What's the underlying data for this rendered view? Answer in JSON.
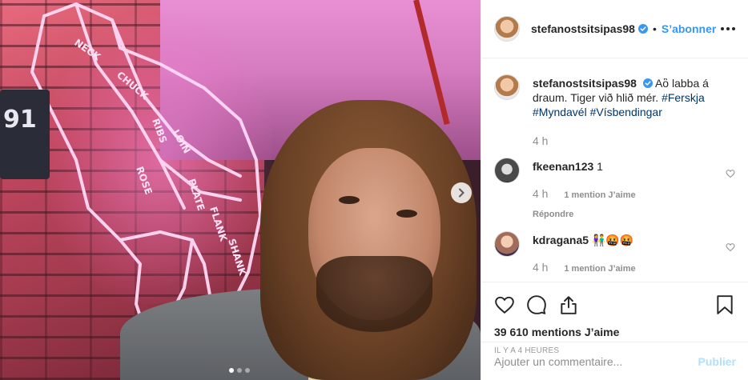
{
  "post": {
    "photo_alt": "selfie photo with pink neon beef cut sign",
    "neon_words": [
      "NECK",
      "CHUCK",
      "RIBS",
      "LOIN",
      "ROSE",
      "PLATE",
      "FLANK",
      "SHANK"
    ],
    "sign_text": "91",
    "carousel": {
      "dots": 3,
      "active": 0
    }
  },
  "header": {
    "username": "stefanostsitsipas98",
    "separator": "•",
    "follow_label": "S’abonner"
  },
  "caption": {
    "username": "stefanostsitsipas98",
    "text": "Aὃ labba á draum. Tiger við hlið mér.",
    "hashtags": [
      "#Ferskja",
      "#Myndavél",
      "#Vísbendingar"
    ],
    "time": "4 h"
  },
  "comments": [
    {
      "username": "fkeenan123",
      "text": "1",
      "time": "4 h",
      "likes": "1 mention J’aime",
      "reply": "Répondre"
    },
    {
      "username": "kdragana5",
      "text": "👫🤬🤬",
      "time": "4 h",
      "likes": "1 mention J’aime"
    }
  ],
  "footer": {
    "likes": "39 610 mentions J’aime",
    "time_ago": "IL Y A 4 HEURES",
    "comment_placeholder": "Ajouter un commentaire...",
    "publish_label": "Publier"
  },
  "colors": {
    "link": "#3897f0",
    "hashtag": "#003569",
    "muted": "#8e8e8e",
    "publish_disabled": "#b2dffc"
  },
  "icons": [
    "verified-badge-icon",
    "more-options-icon",
    "heart-icon",
    "comment-icon",
    "share-icon",
    "bookmark-icon",
    "chevron-right-icon"
  ]
}
